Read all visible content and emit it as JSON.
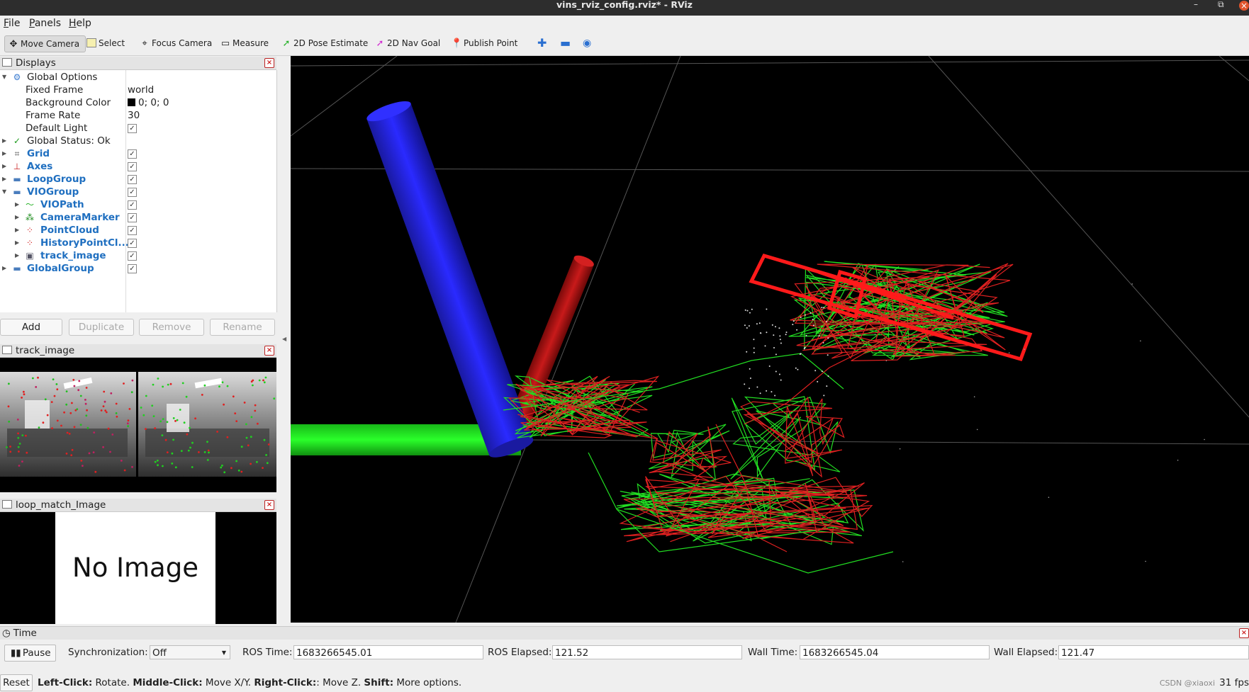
{
  "window": {
    "title": "vins_rviz_config.rviz* - RViz"
  },
  "menubar": {
    "items": [
      {
        "label": "File",
        "mnemonic": "F",
        "rest": "ile"
      },
      {
        "label": "Panels",
        "mnemonic": "P",
        "rest": "anels"
      },
      {
        "label": "Help",
        "mnemonic": "H",
        "rest": "elp"
      }
    ]
  },
  "toolbar": {
    "tools": [
      {
        "label": "Move Camera",
        "icon": "move-camera-icon",
        "active": true
      },
      {
        "label": "Select",
        "icon": "select-icon"
      },
      {
        "label": "Focus Camera",
        "icon": "focus-camera-icon"
      },
      {
        "label": "Measure",
        "icon": "measure-icon"
      },
      {
        "label": "2D Pose Estimate",
        "icon": "pose-estimate-icon",
        "color": "#27b22a"
      },
      {
        "label": "2D Nav Goal",
        "icon": "nav-goal-icon",
        "color": "#d02bd0"
      },
      {
        "label": "Publish Point",
        "icon": "publish-point-icon",
        "color": "#d03020"
      }
    ]
  },
  "displays": {
    "title": "Displays",
    "global_options": {
      "label": "Global Options",
      "fixed_frame_label": "Fixed Frame",
      "fixed_frame": "world",
      "bg_color_label": "Background Color",
      "bg_color": "0; 0; 0",
      "frame_rate_label": "Frame Rate",
      "frame_rate": "30",
      "default_light_label": "Default Light"
    },
    "global_status": "Global Status: Ok",
    "items": [
      {
        "label": "Grid",
        "checked": true
      },
      {
        "label": "Axes",
        "checked": true
      },
      {
        "label": "LoopGroup",
        "checked": true
      },
      {
        "label": "VIOGroup",
        "checked": true
      },
      {
        "label": "VIOPath",
        "checked": true
      },
      {
        "label": "CameraMarker",
        "checked": true
      },
      {
        "label": "PointCloud",
        "checked": true
      },
      {
        "label": "HistoryPointCl...",
        "checked": true
      },
      {
        "label": "track_image",
        "checked": true
      },
      {
        "label": "GlobalGroup",
        "checked": true
      }
    ],
    "buttons": {
      "add": "Add",
      "duplicate": "Duplicate",
      "remove": "Remove",
      "rename": "Rename"
    }
  },
  "track_image_panel": {
    "title": "track_image"
  },
  "loop_panel": {
    "title": "loop_match_Image",
    "placeholder": "No Image"
  },
  "time": {
    "title": "Time",
    "pause": "Pause",
    "sync_label": "Synchronization:",
    "sync_value": "Off",
    "ros_time_label": "ROS Time:",
    "ros_time": "1683266545.01",
    "ros_elapsed_label": "ROS Elapsed:",
    "ros_elapsed": "121.52",
    "wall_time_label": "Wall Time:",
    "wall_time": "1683266545.04",
    "wall_elapsed_label": "Wall Elapsed:",
    "wall_elapsed": "121.47"
  },
  "status": {
    "reset": "Reset",
    "left_click": "Left-Click:",
    "left_action": " Rotate. ",
    "middle_click": "Middle-Click:",
    "middle_action": " Move X/Y. ",
    "right_click": "Right-Click:",
    "right_action": ": Move Z. ",
    "shift": "Shift:",
    "shift_action": " More options.",
    "watermark": "CSDN @xiaoxi",
    "fps": "31 fps"
  },
  "colors": {
    "axis_x": "#cc1010",
    "axis_y": "#10ee10",
    "axis_z": "#1010dd",
    "path_red": "#dd2020",
    "path_green": "#22dd22"
  }
}
